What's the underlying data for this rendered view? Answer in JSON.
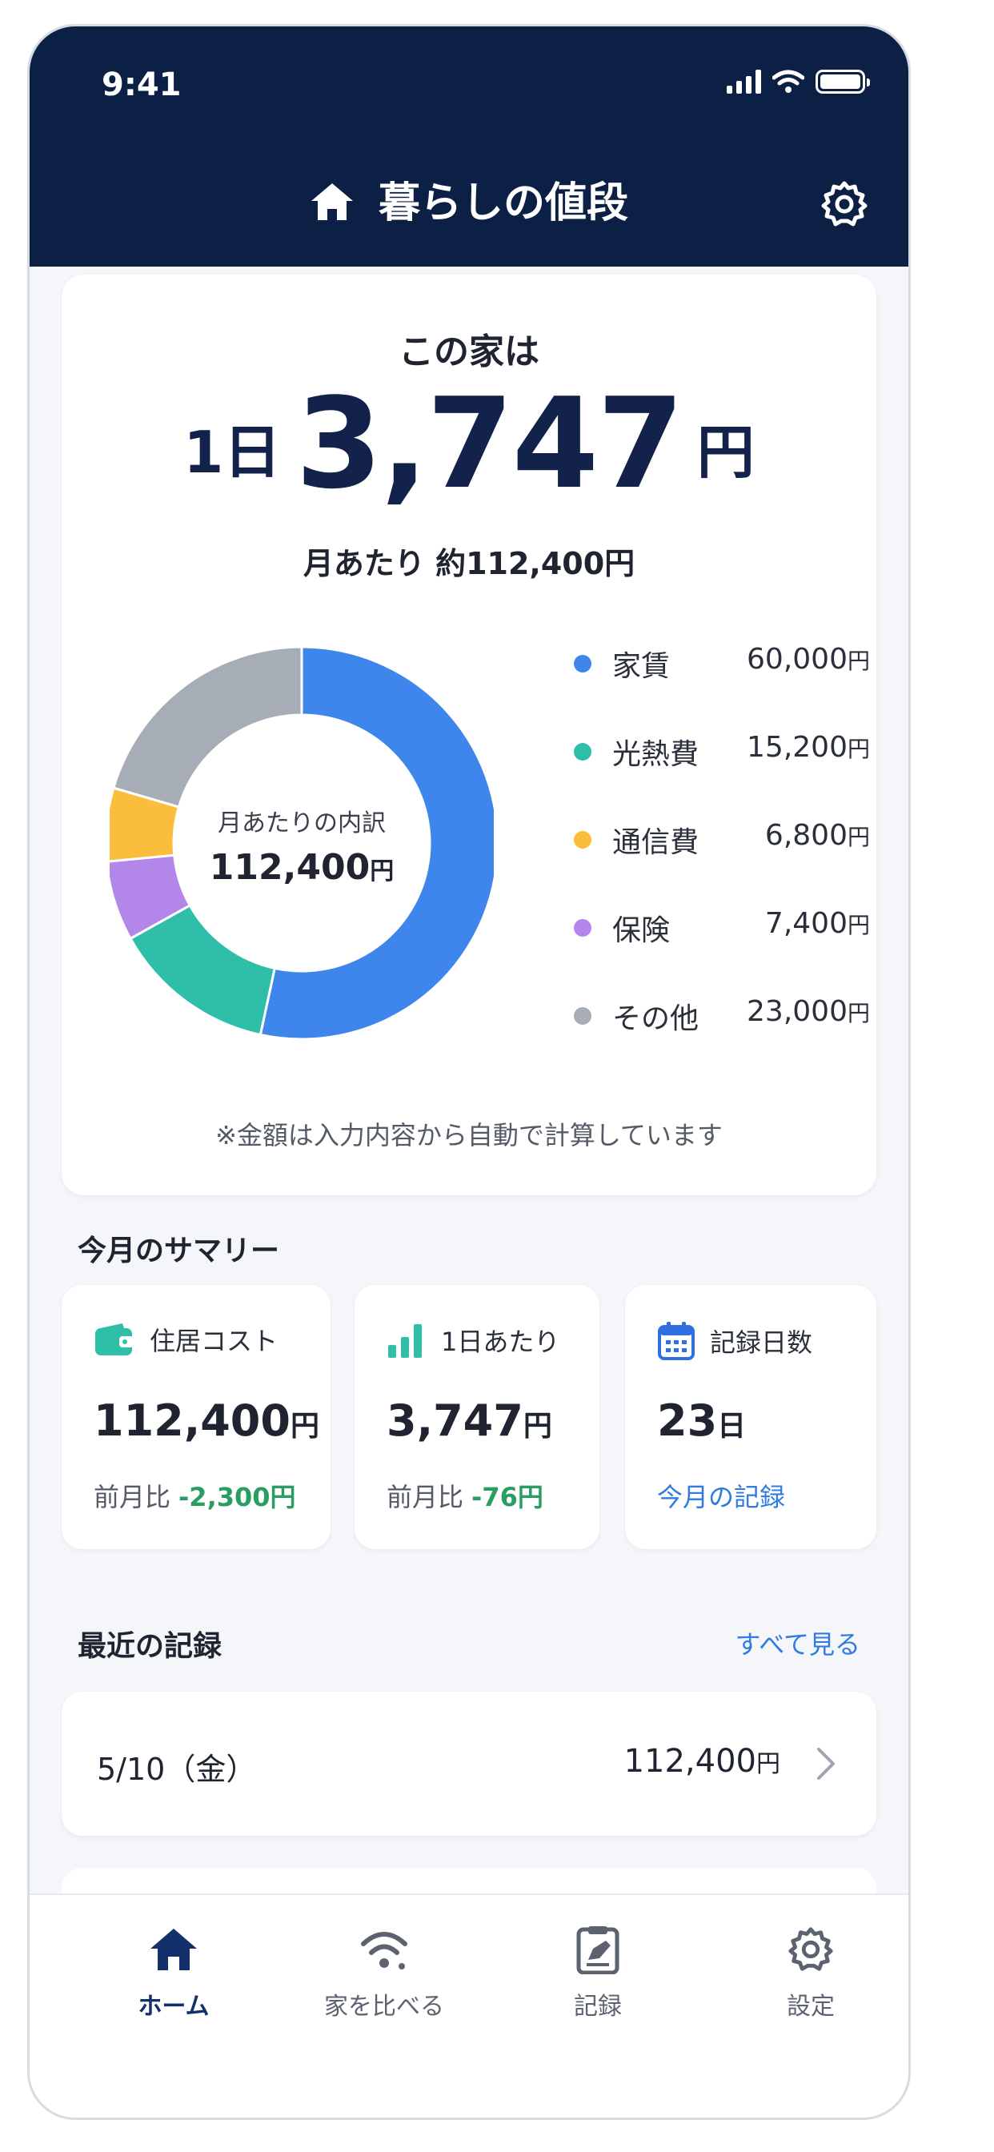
{
  "status_bar": {
    "time": "9:41"
  },
  "header": {
    "title": "暮らしの値段"
  },
  "summary_card": {
    "lead": "この家は",
    "daily_prefix": "1日",
    "daily_amount": "3,747",
    "daily_unit": "円",
    "monthly_label": "月あたり 約112,400円",
    "donut_title": "月あたりの内訳",
    "donut_total": "112,400",
    "donut_total_unit": "円",
    "note": "※金額は入力内容から自動で計算しています"
  },
  "chart_data": {
    "type": "pie",
    "categories": [
      "家賃",
      "光熱費",
      "通信費",
      "保険",
      "その他"
    ],
    "values": [
      60000,
      15200,
      6800,
      7400,
      23000
    ],
    "value_labels": [
      "60,000",
      "15,200",
      "6,800",
      "7,400",
      "23,000"
    ],
    "unit": "円",
    "colors": [
      "#3f86ec",
      "#2fbfa9",
      "#fbbd3c",
      "#b386ea",
      "#a7adb6"
    ],
    "legend_placement": "right"
  },
  "month_summary": {
    "title": "今月のサマリー",
    "cards": [
      {
        "label": "住居コスト",
        "value": "112,400",
        "unit": "円",
        "sub_label": "前月比",
        "delta": "-2,300円"
      },
      {
        "label": "1日あたり",
        "value": "3,747",
        "unit": "円",
        "sub_label": "前月比",
        "delta": "-76円"
      },
      {
        "label": "記録日数",
        "value": "23",
        "unit": "日",
        "link": "今月の記録"
      }
    ]
  },
  "recent": {
    "title": "最近の記録",
    "see_all": "すべて見る",
    "items": [
      {
        "date": "5/10（金）",
        "amount": "112,400",
        "unit": "円"
      }
    ]
  },
  "tabs": [
    {
      "label": "ホーム",
      "active": true
    },
    {
      "label": "家を比べる",
      "active": false
    },
    {
      "label": "記録",
      "active": false
    },
    {
      "label": "設定",
      "active": false
    }
  ],
  "colors": {
    "header_bg": "#0c1f45",
    "accent_blue": "#2f7be0",
    "positive_green": "#2a9d62"
  }
}
